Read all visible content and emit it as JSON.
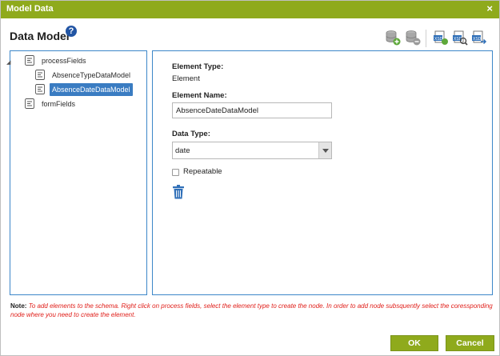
{
  "dialog": {
    "title": "Model Data",
    "close_glyph": "×"
  },
  "header": {
    "title": "Data Model",
    "help_glyph": "?"
  },
  "toolbar": {
    "buttons": [
      {
        "icon": "add-database-icon"
      },
      {
        "icon": "remove-database-icon"
      },
      {
        "icon": "export-schema-icon"
      },
      {
        "icon": "search-schema-icon"
      },
      {
        "icon": "import-schema-icon"
      }
    ]
  },
  "tree": {
    "nodes": [
      {
        "label": "processFields",
        "expanded": true,
        "icon": "schema-node-icon"
      },
      {
        "label": "AbsenceTypeDataModel",
        "selected": false,
        "icon": "schema-node-icon"
      },
      {
        "label": "AbsenceDateDataModel",
        "selected": true,
        "icon": "schema-node-icon"
      },
      {
        "label": "formFields",
        "icon": "schema-node-icon"
      }
    ]
  },
  "details": {
    "element_type_label": "Element Type:",
    "element_type_value": "Element",
    "element_name_label": "Element Name:",
    "element_name_value": "AbsenceDateDataModel",
    "data_type_label": "Data Type:",
    "data_type_value": "date",
    "repeatable_label": "Repeatable",
    "repeatable_checked": false
  },
  "note": {
    "label": "Note:",
    "text": "To add elements to the schema. Right click on process fields, select the element type to create the node. In order to add node subsquently select the coressponding node where you need to create the element."
  },
  "footer": {
    "ok_label": "OK",
    "cancel_label": "Cancel"
  },
  "colors": {
    "accent": "#8faa1c",
    "panel_border": "#3d87c9",
    "selection": "#3a7cc2",
    "note_text": "#e0201b",
    "help": "#2255a4"
  }
}
